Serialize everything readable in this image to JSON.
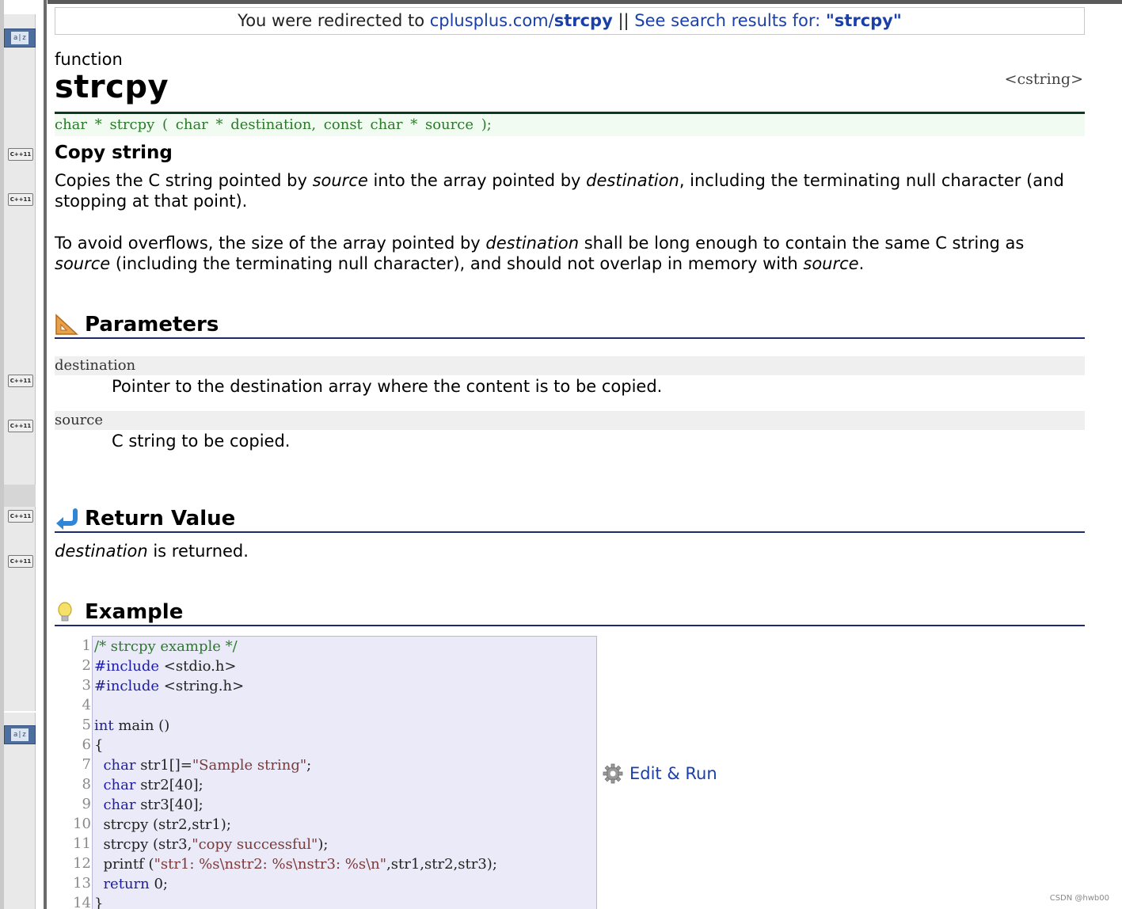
{
  "redirect": {
    "prefix": "You were redirected to ",
    "domain": "cplusplus.com/",
    "page": "strcpy",
    "separator": " || ",
    "see_label": "See search results for: ",
    "query": "\"strcpy\""
  },
  "sidebar": {
    "az_label": "a|z",
    "badges": [
      "C++11",
      "C++11",
      "C++11",
      "C++11",
      "C++11",
      "C++11"
    ]
  },
  "doc": {
    "kind": "function",
    "name": "strcpy",
    "header": "<cstring>",
    "prototype": "char * strcpy ( char * destination, const char * source );",
    "subtitle": "Copy string",
    "para1": {
      "a": "Copies the C string pointed by ",
      "b": "source",
      "c": " into the array pointed by ",
      "d": "destination",
      "e": ", including the terminating null character (and stopping at that point)."
    },
    "para2": {
      "a": "To avoid overflows, the size of the array pointed by ",
      "b": "destination",
      "c": " shall be long enough to contain the same C string as ",
      "d": "source",
      "e": " (including the terminating null character), and should not overlap in memory with ",
      "f": "source",
      "g": "."
    }
  },
  "parameters": {
    "heading": "Parameters",
    "items": [
      {
        "name": "destination",
        "desc": "Pointer to the destination array where the content is to be copied."
      },
      {
        "name": "source",
        "desc": "C string to be copied."
      }
    ]
  },
  "return_value": {
    "heading": "Return Value",
    "term": "destination",
    "rest": " is returned."
  },
  "example": {
    "heading": "Example",
    "line_numbers": [
      "1",
      "2",
      "3",
      "4",
      "5",
      "6",
      "7",
      "8",
      "9",
      "10",
      "11",
      "12",
      "13",
      "14"
    ],
    "edit_run": "Edit & Run",
    "lines": [
      [
        {
          "t": "/* strcpy example */",
          "c": "cm"
        }
      ],
      [
        {
          "t": "#include",
          "c": "kw"
        },
        {
          "t": " <stdio.h>",
          "c": ""
        }
      ],
      [
        {
          "t": "#include",
          "c": "kw"
        },
        {
          "t": " <string.h>",
          "c": ""
        }
      ],
      [
        {
          "t": "",
          "c": ""
        }
      ],
      [
        {
          "t": "int",
          "c": "kw"
        },
        {
          "t": " main ()",
          "c": ""
        }
      ],
      [
        {
          "t": "{",
          "c": ""
        }
      ],
      [
        {
          "t": "  ",
          "c": ""
        },
        {
          "t": "char",
          "c": "kw"
        },
        {
          "t": " str1[]=",
          "c": ""
        },
        {
          "t": "\"Sample string\"",
          "c": "st"
        },
        {
          "t": ";",
          "c": ""
        }
      ],
      [
        {
          "t": "  ",
          "c": ""
        },
        {
          "t": "char",
          "c": "kw"
        },
        {
          "t": " str2[40];",
          "c": ""
        }
      ],
      [
        {
          "t": "  ",
          "c": ""
        },
        {
          "t": "char",
          "c": "kw"
        },
        {
          "t": " str3[40];",
          "c": ""
        }
      ],
      [
        {
          "t": "  strcpy (str2,str1);",
          "c": ""
        }
      ],
      [
        {
          "t": "  strcpy (str3,",
          "c": ""
        },
        {
          "t": "\"copy successful\"",
          "c": "st"
        },
        {
          "t": ");",
          "c": ""
        }
      ],
      [
        {
          "t": "  printf (",
          "c": ""
        },
        {
          "t": "\"str1: %s\\nstr2: %s\\nstr3: %s\\n\"",
          "c": "st"
        },
        {
          "t": ",str1,str2,str3);",
          "c": ""
        }
      ],
      [
        {
          "t": "  ",
          "c": ""
        },
        {
          "t": "return",
          "c": "kw"
        },
        {
          "t": " 0;",
          "c": ""
        }
      ],
      [
        {
          "t": "}",
          "c": ""
        }
      ]
    ]
  },
  "watermark": "CSDN @hwb00"
}
